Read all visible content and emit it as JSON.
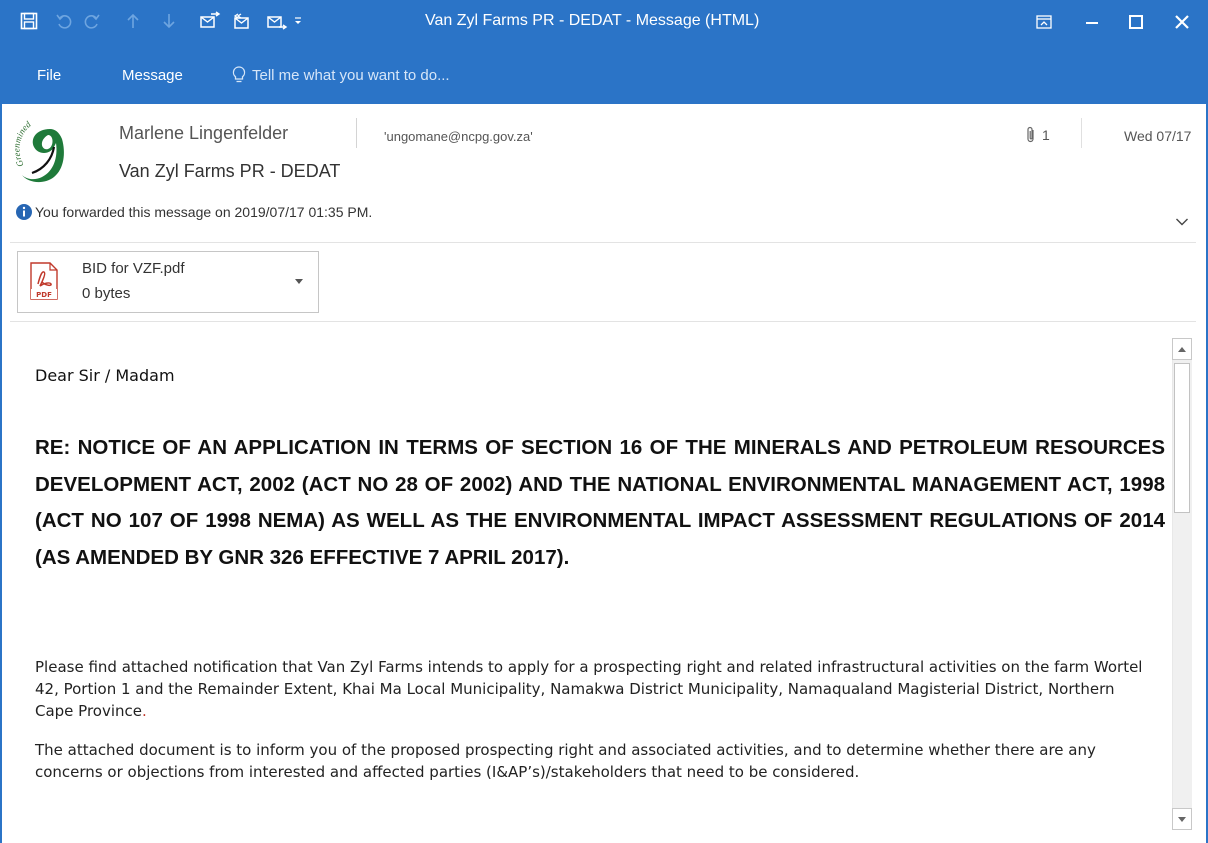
{
  "window": {
    "title": "Van Zyl Farms PR - DEDAT - Message (HTML)",
    "accent_color": "#2b74c7"
  },
  "quick_access": {
    "icons": [
      "save-icon",
      "undo-icon",
      "redo-icon",
      "previous-item-icon",
      "next-item-icon",
      "reply-icon",
      "reply-all-icon",
      "forward-icon",
      "customize-qat-icon"
    ]
  },
  "ribbon": {
    "tabs": [
      {
        "label": "File"
      },
      {
        "label": "Message"
      }
    ],
    "tell_me": {
      "placeholder": "Tell me what you want to do..."
    }
  },
  "header": {
    "sender": "Marlene Lingenfelder",
    "recipient": "'ungomane@ncpg.gov.za'",
    "subject": "Van Zyl Farms PR - DEDAT",
    "info": "You forwarded this message on 2019/07/17 01:35 PM.",
    "attachment_count": "1",
    "date": "Wed 07/17",
    "logo_text": "Greenmined"
  },
  "attachment": {
    "name": "BID for VZF.pdf",
    "size": "0 bytes",
    "type_label": "PDF"
  },
  "body": {
    "greeting": "Dear Sir / Madam",
    "heading": "RE: NOTICE OF AN APPLICATION IN TERMS OF SECTION 16 OF THE MINERALS AND PETROLEUM RESOURCES DEVELOPMENT ACT, 2002 (ACT NO 28 OF 2002) AND THE NATIONAL ENVIRONMENTAL MANAGEMENT ACT, 1998 (ACT NO 107 OF 1998 NEMA) AS WELL AS THE ENVIRONMENTAL IMPACT ASSESSMENT REGULATIONS OF 2014 (AS AMENDED BY GNR 326 EFFECTIVE 7 APRIL 2017).",
    "paragraph1": "Please find attached notification that Van Zyl Farms intends to apply for a prospecting right and related infrastructural activities on the farm Wortel 42, Portion 1 and the Remainder Extent, Khai Ma Local Municipality, Namakwa District Municipality, Namaqualand Magisterial District, Northern Cape Province",
    "paragraph1_end": ".",
    "paragraph2": "The attached document is to inform you of the proposed prospecting  right and associated activities, and to determine whether there are any concerns or objections from interested and affected parties (I&AP’s)/stakeholders that need to be considered."
  }
}
